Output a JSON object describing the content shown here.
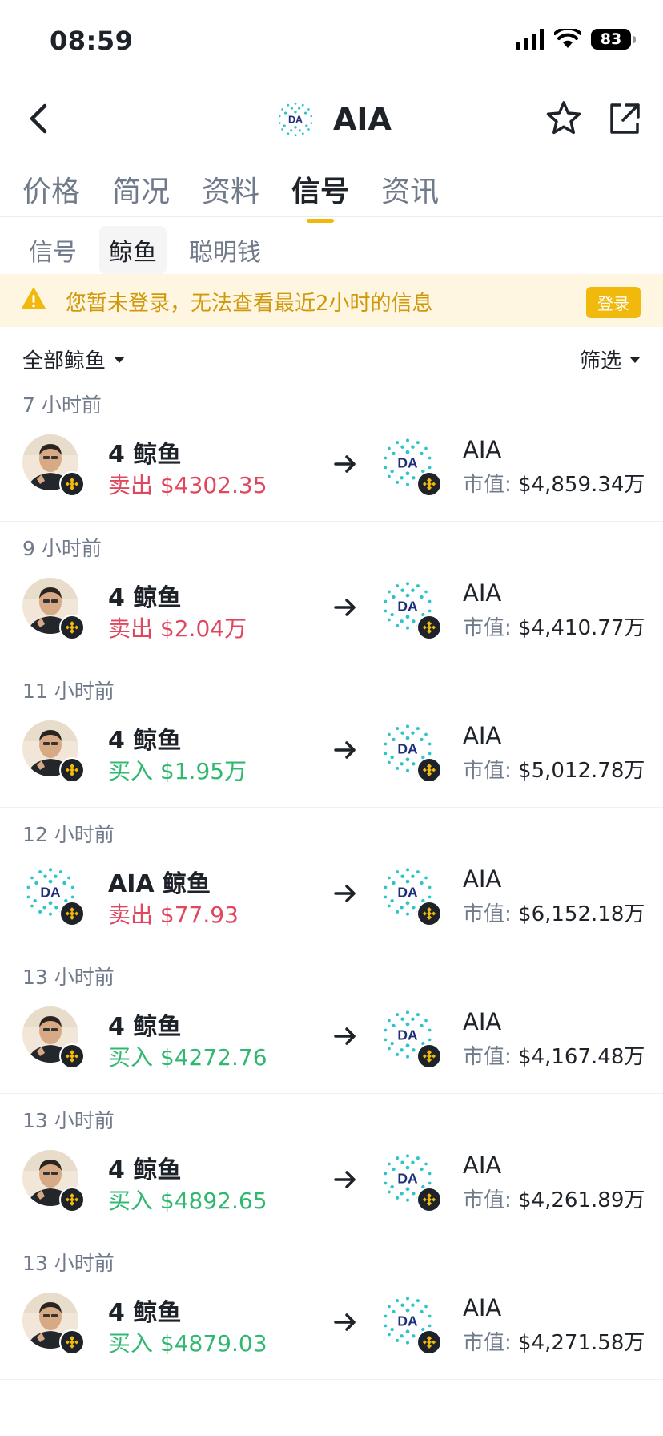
{
  "status_bar": {
    "time": "08:59",
    "battery": "83"
  },
  "header": {
    "title": "AIA",
    "logo_text": "DA"
  },
  "main_tabs": [
    {
      "label": "价格",
      "active": false
    },
    {
      "label": "简况",
      "active": false
    },
    {
      "label": "资料",
      "active": false
    },
    {
      "label": "信号",
      "active": true
    },
    {
      "label": "资讯",
      "active": false
    }
  ],
  "sub_tabs": [
    {
      "label": "信号",
      "active": false
    },
    {
      "label": "鲸鱼",
      "active": true
    },
    {
      "label": "聪明钱",
      "active": false
    }
  ],
  "warning": {
    "text": "您暂未登录，无法查看最近2小时的信息",
    "button": "登录"
  },
  "filters": {
    "left": "全部鲸鱼",
    "right": "筛选"
  },
  "colors": {
    "accent": "#f0b90b",
    "sell": "#e0465e",
    "buy": "#31b870",
    "warning_bg": "#fef6e0",
    "warning_text": "#d0980b"
  },
  "signals": [
    {
      "time": "7 小时前",
      "actor": "4 鲸鱼",
      "actor_type": "photo",
      "action": "卖出",
      "amount": "$4302.35",
      "side": "sell",
      "token": "AIA",
      "mcap_label": "市值:",
      "mcap": "$4,859.34万"
    },
    {
      "time": "9 小时前",
      "actor": "4 鲸鱼",
      "actor_type": "photo",
      "action": "卖出",
      "amount": "$2.04万",
      "side": "sell",
      "token": "AIA",
      "mcap_label": "市值:",
      "mcap": "$4,410.77万"
    },
    {
      "time": "11 小时前",
      "actor": "4 鲸鱼",
      "actor_type": "photo",
      "action": "买入",
      "amount": "$1.95万",
      "side": "buy",
      "token": "AIA",
      "mcap_label": "市值:",
      "mcap": "$5,012.78万"
    },
    {
      "time": "12 小时前",
      "actor": "AIA 鲸鱼",
      "actor_type": "token",
      "action": "卖出",
      "amount": "$77.93",
      "side": "sell",
      "token": "AIA",
      "mcap_label": "市值:",
      "mcap": "$6,152.18万"
    },
    {
      "time": "13 小时前",
      "actor": "4 鲸鱼",
      "actor_type": "photo",
      "action": "买入",
      "amount": "$4272.76",
      "side": "buy",
      "token": "AIA",
      "mcap_label": "市值:",
      "mcap": "$4,167.48万"
    },
    {
      "time": "13 小时前",
      "actor": "4 鲸鱼",
      "actor_type": "photo",
      "action": "买入",
      "amount": "$4892.65",
      "side": "buy",
      "token": "AIA",
      "mcap_label": "市值:",
      "mcap": "$4,261.89万"
    },
    {
      "time": "13 小时前",
      "actor": "4 鲸鱼",
      "actor_type": "photo",
      "action": "买入",
      "amount": "$4879.03",
      "side": "buy",
      "token": "AIA",
      "mcap_label": "市值:",
      "mcap": "$4,271.58万"
    }
  ]
}
